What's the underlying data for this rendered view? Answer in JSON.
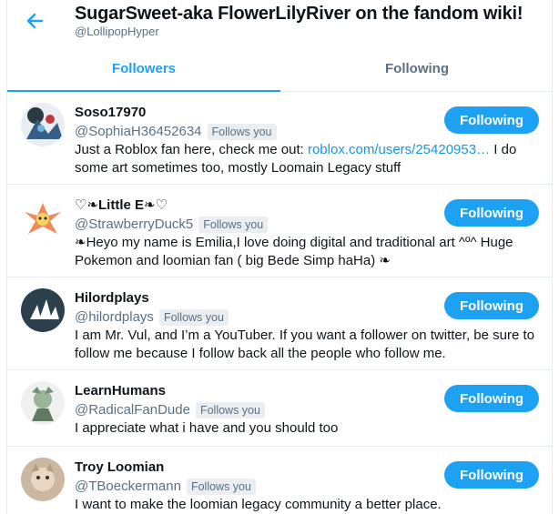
{
  "header": {
    "back_icon": "arrow-left-icon",
    "title": "SugarSweet-aka FlowerLilyRiver on the fandom wiki!",
    "handle": "@LollipopHyper"
  },
  "tabs": [
    {
      "label": "Followers",
      "active": true
    },
    {
      "label": "Following",
      "active": false
    }
  ],
  "colors": {
    "accent": "#1da1f2",
    "link": "#1b95e0",
    "muted": "#5b7083",
    "border": "#e6ecf0"
  },
  "users": [
    {
      "name": "Soso17970",
      "handle": "@SophiaH36452634",
      "badge": "Follows you",
      "button": "Following",
      "bio_before": "Just a Roblox fan here, check me out: ",
      "bio_link": "roblox.com/users/25420953…",
      "bio_after": " I do some art sometimes too, mostly Loomain Legacy stuff"
    },
    {
      "name": "♡❧Little E❧♡",
      "handle": "@StrawberryDuck5",
      "badge": "Follows you",
      "button": "Following",
      "bio": "❧Heyo my name is Emilia,I love doing digital and traditional art ^º^ Huge Pokemon and loomian fan ( big Bede Simp haHa) ❧"
    },
    {
      "name": "Hilordplays",
      "handle": "@hilordplays",
      "badge": "Follows you",
      "button": "Following",
      "bio": "I am Mr. Vul, and I’m a YouTuber. If you want a follower on twitter, be sure to follow me because I follow back all the people who follow me."
    },
    {
      "name": "LearnHumans",
      "handle": "@RadicalFanDude",
      "badge": "Follows you",
      "button": "Following",
      "bio": "I appreciate what i have and you should too"
    },
    {
      "name": "Troy Loomian",
      "handle": "@TBoeckermann",
      "badge": "Follows you",
      "button": "Following",
      "bio": "I want to make the loomian legacy community a better place."
    }
  ]
}
